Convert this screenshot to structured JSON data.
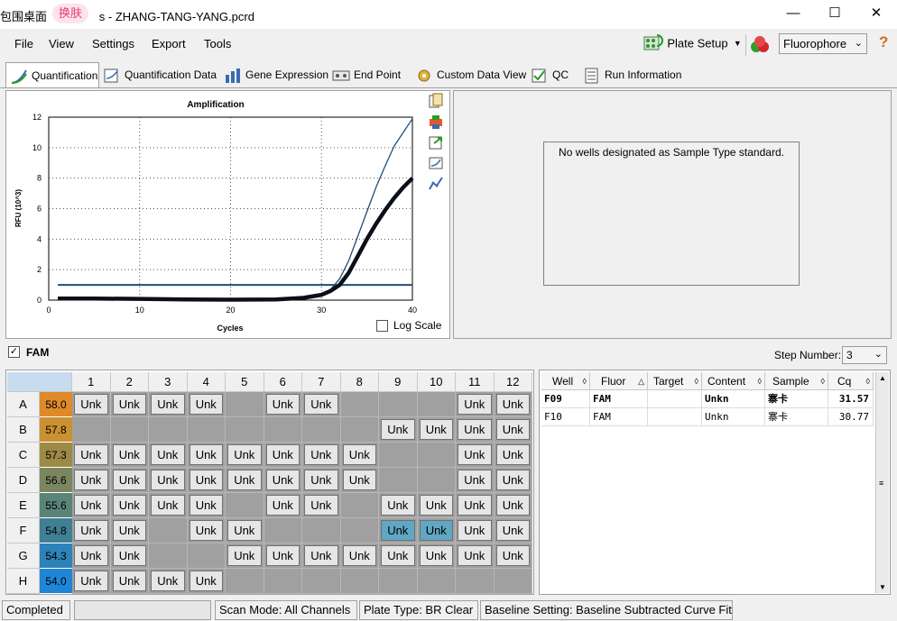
{
  "window": {
    "title": "包围桌面                s - ZHANG-TANG-YANG.pcrd",
    "badge": "换肤",
    "minimize": "—",
    "maximize": "☐",
    "close": "✕"
  },
  "menu": {
    "file": "File",
    "view": "View",
    "settings": "Settings",
    "export": "Export",
    "tools": "Tools"
  },
  "toolbar": {
    "plate_setup": "Plate Setup",
    "fluorophore": "Fluorophore",
    "help": "?"
  },
  "tabs": [
    "Quantification",
    "Quantification Data",
    "Gene Expression",
    "End Point",
    "Custom Data View",
    "QC",
    "Run Information"
  ],
  "chart_data": {
    "type": "line",
    "title": "Amplification",
    "xlabel": "Cycles",
    "ylabel": "RFU (10^3)",
    "xlim": [
      0,
      40
    ],
    "ylim": [
      0,
      12
    ],
    "xticks": [
      0,
      10,
      20,
      30,
      40
    ],
    "yticks": [
      0,
      2,
      4,
      6,
      8,
      10,
      12
    ],
    "grid": true,
    "threshold": 1.0,
    "series": [
      {
        "x": [
          1,
          5,
          10,
          15,
          20,
          25,
          28,
          30,
          31,
          32,
          33,
          34,
          35,
          36,
          37,
          38,
          39,
          40
        ],
        "y": [
          0.05,
          0.05,
          0.05,
          0.04,
          0.04,
          0.06,
          0.15,
          0.35,
          0.7,
          1.4,
          2.6,
          4.2,
          5.8,
          7.4,
          8.8,
          10.1,
          11.0,
          11.9
        ]
      },
      {
        "x": [
          1,
          5,
          10,
          15,
          20,
          25,
          28,
          30,
          31,
          32,
          33,
          34,
          35,
          36,
          37,
          38,
          39,
          40
        ],
        "y": [
          0.1,
          0.1,
          0.08,
          0.05,
          0.03,
          0.05,
          0.15,
          0.35,
          0.6,
          1.0,
          1.8,
          2.9,
          4.0,
          5.0,
          5.9,
          6.7,
          7.4,
          8.0
        ]
      }
    ],
    "log_scale_label": "Log Scale"
  },
  "right_panel": {
    "message": "No wells designated as Sample Type standard."
  },
  "fam": {
    "label": "FAM",
    "step_label": "Step Number:",
    "step_value": "3"
  },
  "plate": {
    "columns": [
      "1",
      "2",
      "3",
      "4",
      "5",
      "6",
      "7",
      "8",
      "9",
      "10",
      "11",
      "12"
    ],
    "rows": [
      "A",
      "B",
      "C",
      "D",
      "E",
      "F",
      "G",
      "H"
    ],
    "temps": [
      "58.0",
      "57.8",
      "57.3",
      "56.6",
      "55.6",
      "54.8",
      "54.3",
      "54.0"
    ],
    "temp_colors": [
      "#e0892a",
      "#c99130",
      "#9e8a45",
      "#7b8560",
      "#5a8478",
      "#3f8094",
      "#2d82b8",
      "#1f86d6"
    ],
    "label": "Unk",
    "wells": [
      [
        1,
        1,
        1,
        1,
        0,
        1,
        1,
        0,
        0,
        0,
        1,
        1
      ],
      [
        0,
        0,
        0,
        0,
        0,
        0,
        0,
        0,
        1,
        1,
        1,
        1
      ],
      [
        1,
        1,
        1,
        1,
        1,
        1,
        1,
        1,
        0,
        0,
        1,
        1
      ],
      [
        1,
        1,
        1,
        1,
        1,
        1,
        1,
        1,
        0,
        0,
        1,
        1
      ],
      [
        1,
        1,
        1,
        1,
        0,
        1,
        1,
        0,
        1,
        1,
        1,
        1
      ],
      [
        1,
        1,
        0,
        1,
        1,
        0,
        0,
        0,
        2,
        2,
        1,
        1
      ],
      [
        1,
        1,
        0,
        0,
        1,
        1,
        1,
        1,
        1,
        1,
        1,
        1
      ],
      [
        1,
        1,
        1,
        1,
        0,
        0,
        0,
        0,
        0,
        0,
        0,
        0
      ]
    ]
  },
  "table": {
    "headers": [
      "Well",
      "Fluor",
      "Target",
      "Content",
      "Sample",
      "Cq"
    ],
    "rows": [
      [
        "F09",
        "FAM",
        "",
        "Unkn",
        "寨卡",
        "31.57"
      ],
      [
        "F10",
        "FAM",
        "",
        "Unkn",
        "寨卡",
        "30.77"
      ]
    ]
  },
  "status": {
    "state": "Completed",
    "scan_mode": "Scan Mode: All Channels",
    "plate_type": "Plate Type: BR Clear",
    "baseline": "Baseline Setting: Baseline Subtracted Curve Fit"
  }
}
